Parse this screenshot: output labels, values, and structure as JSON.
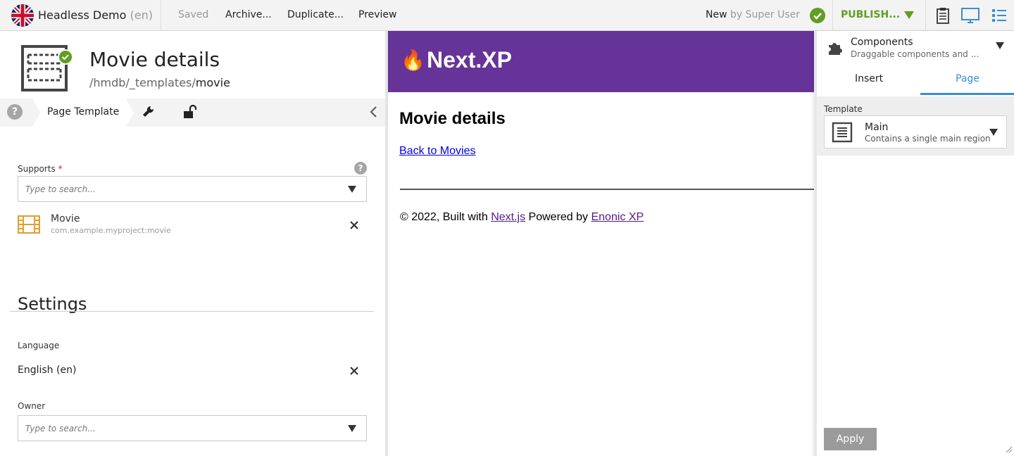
{
  "topbar": {
    "project_name": "Headless Demo",
    "project_lang": "(en)",
    "saved_label": "Saved",
    "archive_label": "Archive...",
    "duplicate_label": "Duplicate...",
    "preview_label": "Preview",
    "status_label": "New",
    "status_by": "by Super User",
    "publish_label": "PUBLISH..."
  },
  "wizard": {
    "title": "Movie details",
    "path_prefix": "/hmdb/_templates/",
    "path_name": "movie",
    "step_help": "?",
    "step_active_label": "Page Template",
    "supports": {
      "label": "Supports",
      "required_mark": "*",
      "help": "?",
      "placeholder": "Type to search...",
      "selected": {
        "name": "Movie",
        "key": "com.example.myproject:movie"
      }
    },
    "settings": {
      "title": "Settings",
      "language_label": "Language",
      "language_value": "English (en)",
      "owner_label": "Owner",
      "owner_placeholder": "Type to search..."
    }
  },
  "preview": {
    "flame": "🔥",
    "brand": "Next.XP",
    "title": "Movie details",
    "back_link": "Back to Movies",
    "footer_prefix": "© 2022, Built with ",
    "footer_link1": "Next.js",
    "footer_mid": " Powered by ",
    "footer_link2": "Enonic XP"
  },
  "context_panel": {
    "widget_title": "Components",
    "widget_subtitle": "Draggable components and pa...",
    "tabs": [
      {
        "label": "Insert",
        "active": false
      },
      {
        "label": "Page",
        "active": true
      }
    ],
    "template_label": "Template",
    "template_selected": {
      "name": "Main",
      "description": "Contains a single main region"
    },
    "apply_label": "Apply"
  },
  "colors": {
    "accent_green": "#609e24",
    "accent_blue": "#3b8cd6",
    "preview_header": "#663399",
    "movie_icon": "#e0a030"
  },
  "icons": [
    "uk-flag-icon",
    "check-circle-icon",
    "clipboard-icon",
    "monitor-icon",
    "list-icon",
    "page-template-icon",
    "help-icon",
    "wrench-icon",
    "unlock-icon",
    "chevron-left-icon",
    "film-icon",
    "close-icon",
    "puzzle-icon",
    "document-icon",
    "resize-grip-icon"
  ]
}
